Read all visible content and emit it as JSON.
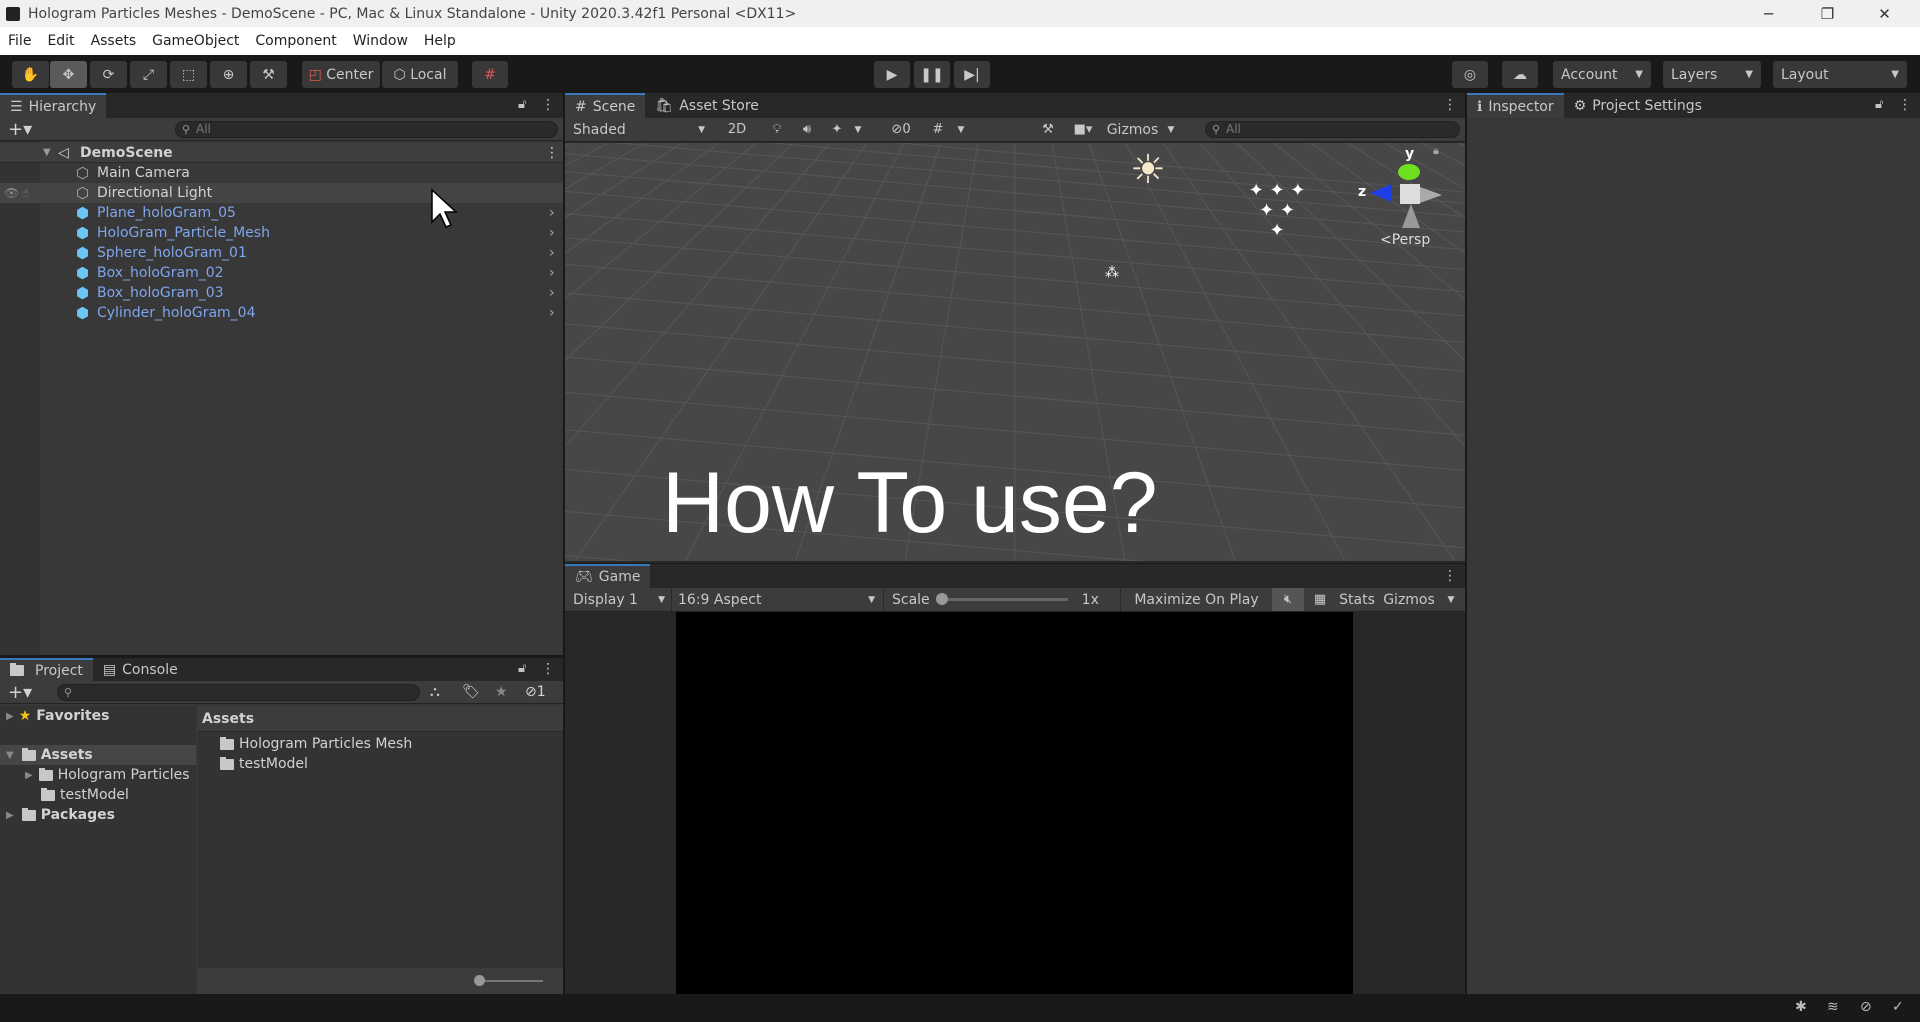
{
  "window": {
    "title": "Hologram Particles Meshes - DemoScene - PC, Mac & Linux Standalone - Unity 2020.3.42f1 Personal <DX11>",
    "minimize": "─",
    "restore": "❐",
    "close": "✕"
  },
  "menu": [
    "File",
    "Edit",
    "Assets",
    "GameObject",
    "Component",
    "Window",
    "Help"
  ],
  "toolbar": {
    "center": "Center",
    "local": "Local",
    "account": "Account",
    "layers": "Layers",
    "layout": "Layout",
    "active_tool": "move"
  },
  "hierarchy": {
    "tab": "Hierarchy",
    "search_placeholder": "All",
    "scene": "DemoScene",
    "items": [
      {
        "name": "Main Camera",
        "prefab": false
      },
      {
        "name": "Directional Light",
        "prefab": false
      },
      {
        "name": "Plane_holoGram_05",
        "prefab": true
      },
      {
        "name": "HoloGram_Particle_Mesh",
        "prefab": true
      },
      {
        "name": "Sphere_holoGram_01",
        "prefab": true
      },
      {
        "name": "Box_holoGram_02",
        "prefab": true
      },
      {
        "name": "Box_holoGram_03",
        "prefab": true
      },
      {
        "name": "Cylinder_holoGram_04",
        "prefab": true
      }
    ]
  },
  "scene": {
    "tabs": [
      "Scene",
      "Asset Store"
    ],
    "shading": "Shaded",
    "mode_2d": "2D",
    "hidden_count": "0",
    "gizmos": "Gizmos",
    "search_placeholder": "All",
    "projection": "Persp",
    "axis_y": "y",
    "axis_z": "z",
    "overlay_text": "How To use?"
  },
  "game": {
    "tab": "Game",
    "display": "Display 1",
    "aspect": "16:9 Aspect",
    "scale_label": "Scale",
    "scale_value": "1x",
    "maximize": "Maximize On Play",
    "stats": "Stats",
    "gizmos": "Gizmos"
  },
  "inspector": {
    "tabs": [
      "Inspector",
      "Project Settings"
    ]
  },
  "project": {
    "tabs": [
      "Project",
      "Console"
    ],
    "hidden_count": "1",
    "favorites": "Favorites",
    "assets": "Assets",
    "tree": [
      "Hologram Particles",
      "testModel"
    ],
    "packages": "Packages",
    "breadcrumb": "Assets",
    "files": [
      "Hologram Particles Mesh",
      "testModel"
    ]
  },
  "colors": {
    "accent": "#3a79bb",
    "prefab_text": "#7fa5ec",
    "panel": "#383838",
    "toolbar": "#191919"
  }
}
